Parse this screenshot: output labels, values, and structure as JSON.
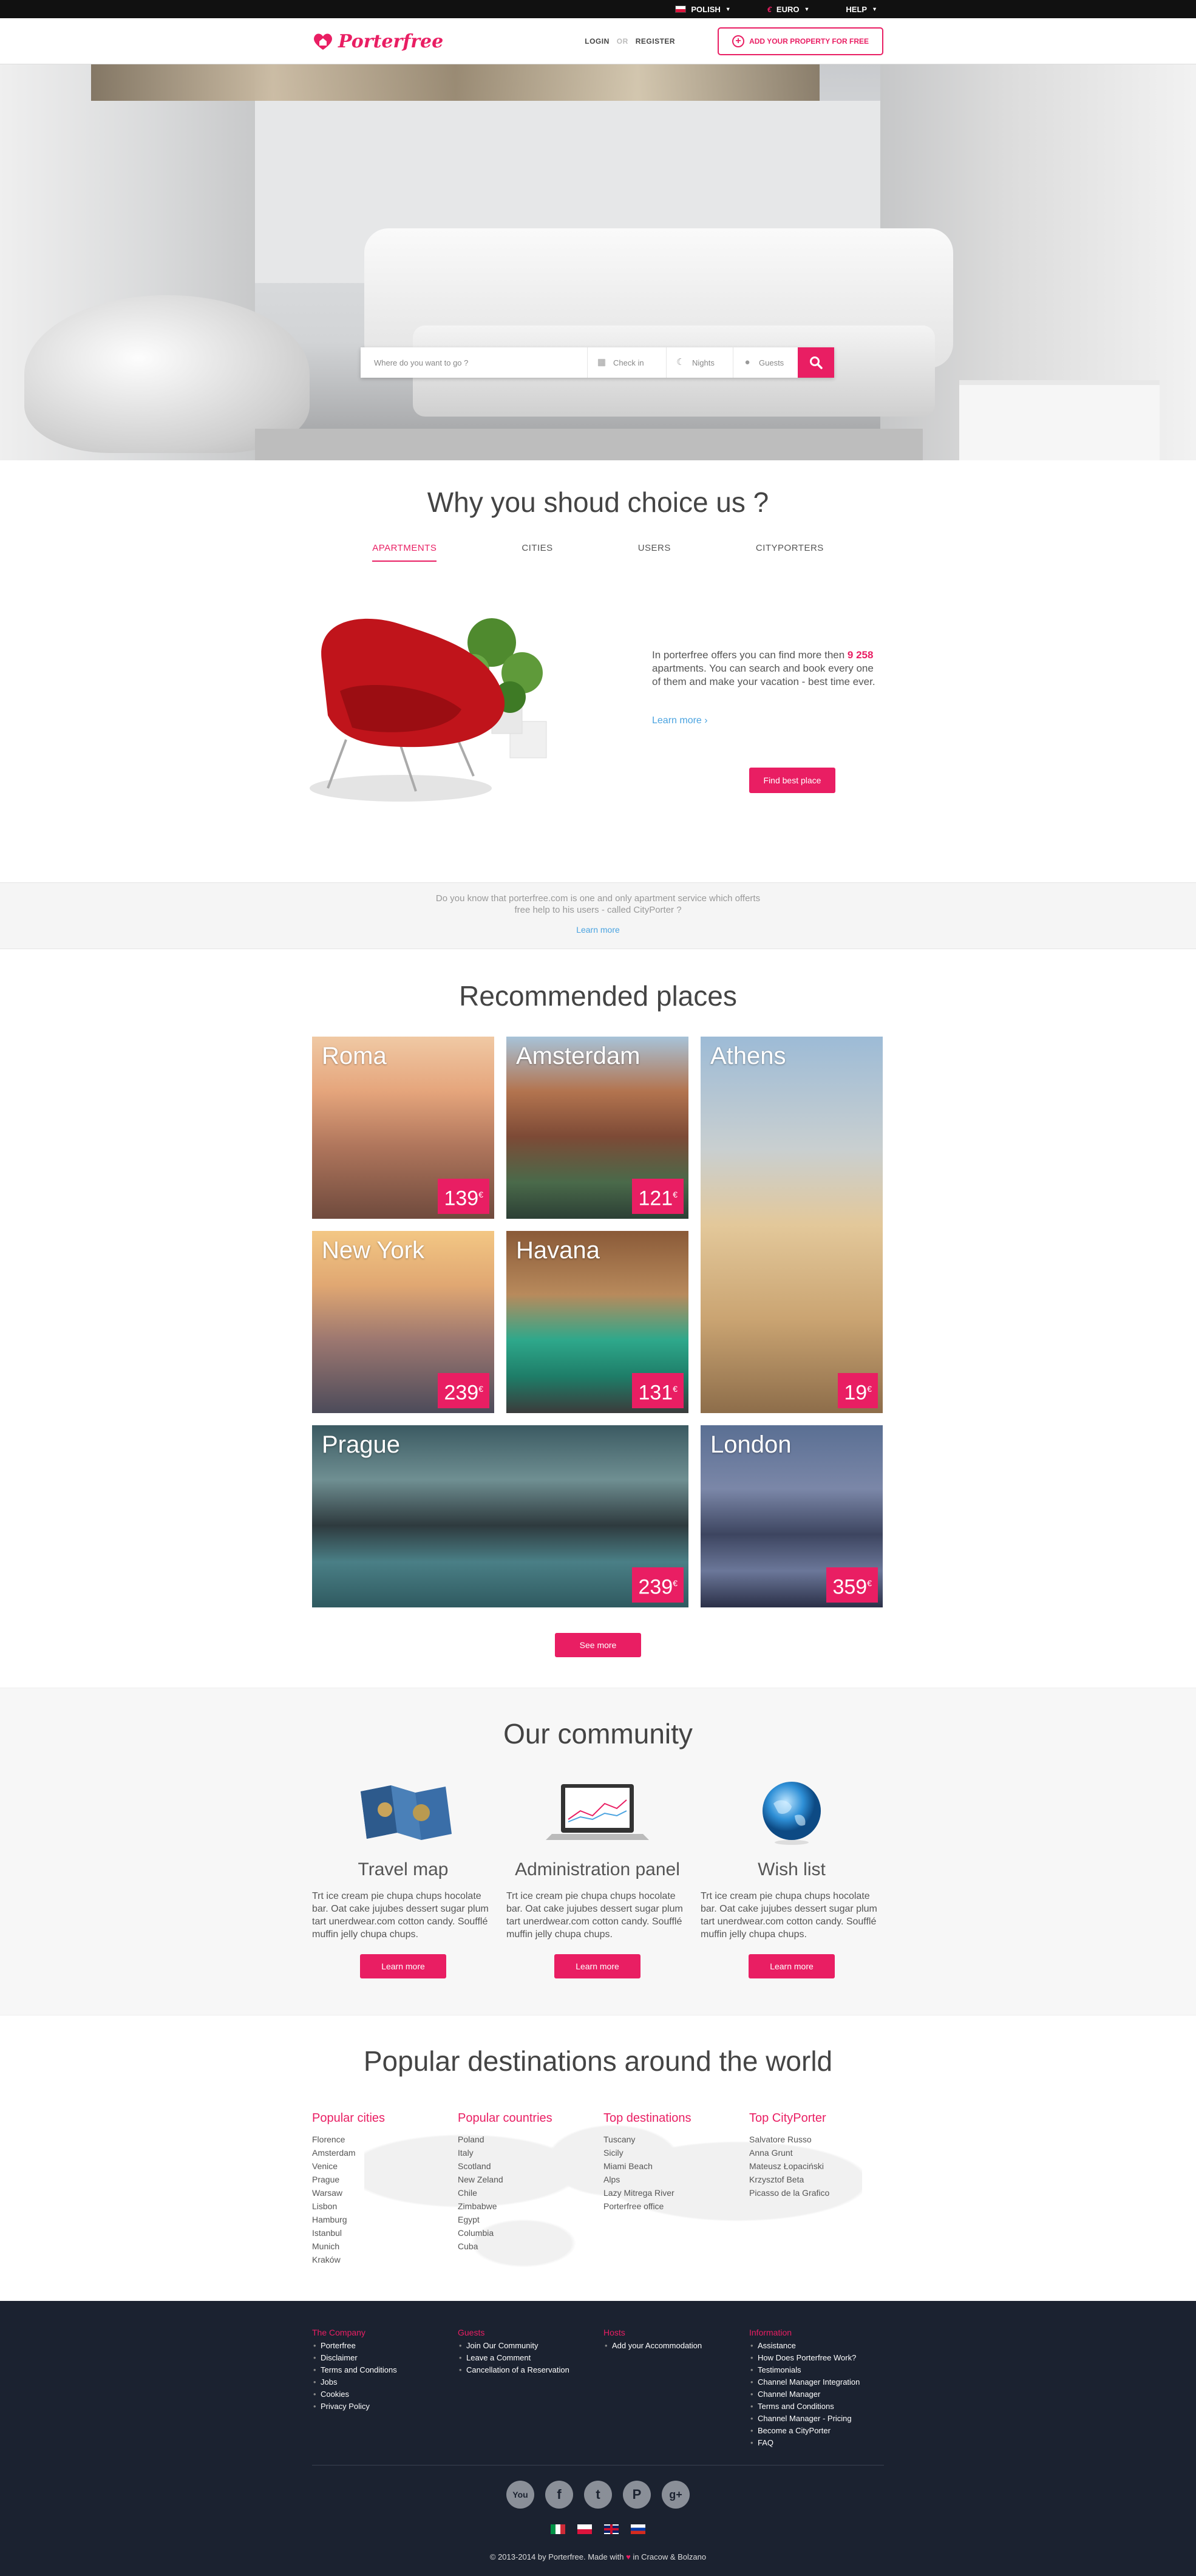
{
  "topbar": {
    "language": "POLISH",
    "currency_symbol": "€",
    "currency": "EURO",
    "help": "HELP"
  },
  "header": {
    "logo_text": "Porterfree",
    "login": "LOGIN",
    "or": "OR",
    "register": "REGISTER",
    "add_property": "ADD YOUR PROPERTY FOR FREE"
  },
  "search": {
    "where_placeholder": "Where do you want to go ?",
    "checkin": "Check in",
    "nights": "Nights",
    "guests": "Guests"
  },
  "why": {
    "title": "Why you shoud choice us ?",
    "tabs": [
      "APARTMENTS",
      "CITIES",
      "USERS",
      "CITYPORTERS"
    ],
    "text_before": "In porterfree offers you can find more then ",
    "count": "9 258",
    "text_after": " apartments. You can search and book every one of them and make your vacation - best time ever.",
    "learn_more": "Learn more  ›",
    "find_button": "Find best place"
  },
  "know": {
    "line1": "Do you know that porterfree.com is one and only apartment service which offerts",
    "line2": "free help to his users - called CityPorter ?",
    "learn_more": "Learn more"
  },
  "places": {
    "title": "Recommended places",
    "items": [
      {
        "name": "Roma",
        "price": "139",
        "cur": "€"
      },
      {
        "name": "Amsterdam",
        "price": "121",
        "cur": "€"
      },
      {
        "name": "Athens",
        "price": "19",
        "cur": "€"
      },
      {
        "name": "New York",
        "price": "239",
        "cur": "€"
      },
      {
        "name": "Havana",
        "price": "131",
        "cur": "€"
      },
      {
        "name": "Prague",
        "price": "239",
        "cur": "€"
      },
      {
        "name": "London",
        "price": "359",
        "cur": "€"
      }
    ],
    "see_more": "See more"
  },
  "community": {
    "title": "Our community",
    "items": [
      {
        "title": "Travel map",
        "text": "Trt ice cream pie chupa chups hocolate bar. Oat cake jujubes dessert sugar plum tart unerdwear.com cotton candy. Soufflé muffin jelly chupa chups.",
        "button": "Learn more"
      },
      {
        "title": "Administration panel",
        "text": "Trt ice cream pie chupa chups hocolate bar. Oat cake jujubes dessert sugar plum tart unerdwear.com cotton candy. Soufflé muffin jelly chupa chups.",
        "button": "Learn more"
      },
      {
        "title": "Wish list",
        "text": "Trt ice cream pie chupa chups hocolate bar. Oat cake jujubes dessert sugar plum tart unerdwear.com cotton candy. Soufflé muffin jelly chupa chups.",
        "button": "Learn more"
      }
    ]
  },
  "destinations": {
    "title": "Popular destinations around the world",
    "columns": [
      {
        "heading": "Popular cities",
        "items": [
          "Florence",
          "Amsterdam",
          "Venice",
          "Prague",
          "Warsaw",
          "Lisbon",
          "Hamburg",
          "Istanbul",
          "Munich",
          "Kraków"
        ]
      },
      {
        "heading": "Popular countries",
        "items": [
          "Poland",
          "Italy",
          "Scotland",
          "New Zeland",
          "Chile",
          "Zimbabwe",
          "Egypt",
          "Columbia",
          "Cuba"
        ]
      },
      {
        "heading": "Top destinations",
        "items": [
          "Tuscany",
          "Sicily",
          "Miami Beach",
          "Alps",
          "Lazy Mitrega River",
          "Porterfree office"
        ]
      },
      {
        "heading": "Top CityPorter",
        "items": [
          "Salvatore Russo",
          "Anna Grunt",
          "Mateusz Łopaciński",
          "Krzysztof Beta",
          "Picasso de la Grafico"
        ]
      }
    ]
  },
  "footer": {
    "columns": [
      {
        "heading": "The Company",
        "items": [
          "Porterfree",
          "Disclaimer",
          "Terms and Conditions",
          "Jobs",
          "Cookies",
          "Privacy Policy"
        ]
      },
      {
        "heading": "Guests",
        "items": [
          "Join Our Community",
          "Leave a Comment",
          "Cancellation of a Reservation"
        ]
      },
      {
        "heading": "Hosts",
        "items": [
          "Add your Accommodation"
        ]
      },
      {
        "heading": "Information",
        "items": [
          "Assistance",
          "How Does Porterfree Work?",
          "Testimonials",
          "Channel Manager Integration",
          "Channel Manager",
          "Terms and Conditions",
          "Channel Manager - Pricing",
          "Become a CityPorter",
          "FAQ"
        ]
      }
    ],
    "social": [
      {
        "name": "youtube-icon",
        "glyph": "You"
      },
      {
        "name": "facebook-icon",
        "glyph": "f"
      },
      {
        "name": "twitter-icon",
        "glyph": "t"
      },
      {
        "name": "pinterest-icon",
        "glyph": "P"
      },
      {
        "name": "googleplus-icon",
        "glyph": "g+"
      }
    ],
    "copyright_before": "© 2013-2014 by Porterfree. Made with ",
    "heart": "♥",
    "copyright_after": " in Cracow & Bolzano"
  },
  "colors": {
    "accent": "#e91e63",
    "link": "#4aa3e0",
    "footer_bg": "#1b2230"
  }
}
